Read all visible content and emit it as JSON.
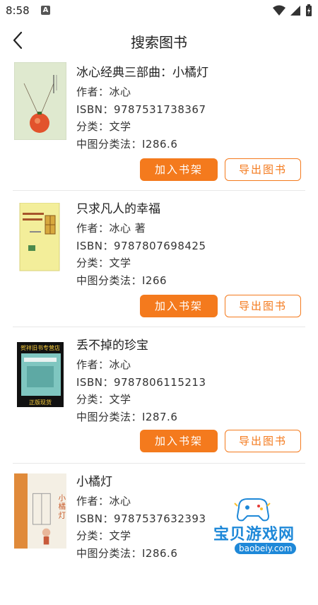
{
  "status_bar": {
    "time": "8:58",
    "notification_icon": "A"
  },
  "header": {
    "title": "搜索图书"
  },
  "books": [
    {
      "title": "冰心经典三部曲：小橘灯",
      "author": "作者：冰心",
      "isbn": "ISBN：9787531738367",
      "category": "分类：文学",
      "clc": "中图分类法：I286.6",
      "add_label": "加入书架",
      "export_label": "导出图书"
    },
    {
      "title": "只求凡人的幸福",
      "author": "作者：冰心 著",
      "isbn": "ISBN：9787807698425",
      "category": "分类：文学",
      "clc": "中图分类法：I266",
      "add_label": "加入书架",
      "export_label": "导出图书"
    },
    {
      "title": "丢不掉的珍宝",
      "author": "作者：冰心",
      "isbn": "ISBN：9787806115213",
      "category": "分类：文学",
      "clc": "中图分类法：I287.6",
      "add_label": "加入书架",
      "export_label": "导出图书",
      "cover_banner_top": "贺祥旧书专营店",
      "cover_banner_bottom": "正版现货"
    },
    {
      "title": "小橘灯",
      "author": "作者：冰心",
      "isbn": "ISBN：9787537632393",
      "category": "分类：文学",
      "clc": "中图分类法：I286.6",
      "cover_text": "小橘灯"
    }
  ],
  "watermark": {
    "text": "宝贝游戏网",
    "url": "baobeiy.com"
  },
  "colors": {
    "accent": "#f47a1d",
    "divider": "#e8e8e8",
    "watermark": "#1e88d8"
  }
}
